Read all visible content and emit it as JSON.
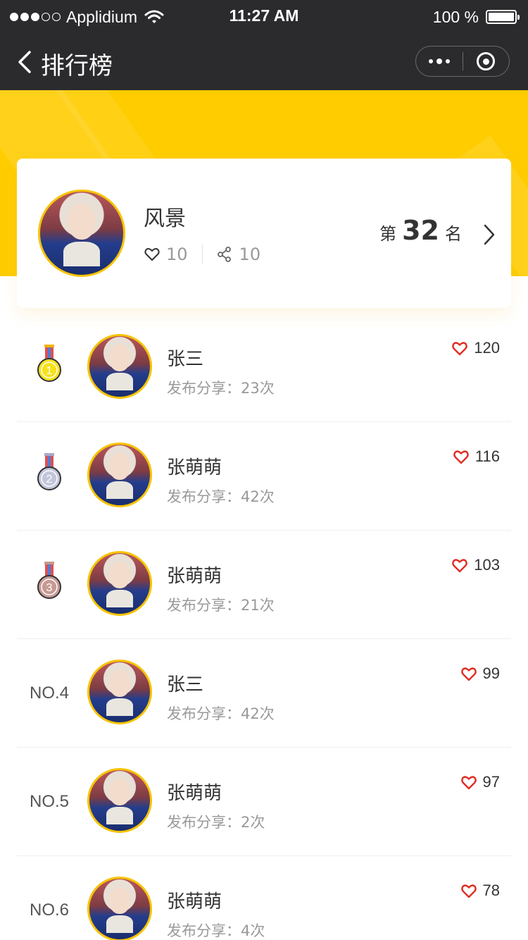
{
  "status_bar": {
    "carrier": "Applidium",
    "time": "11:27 AM",
    "battery": "100 %",
    "signal_bars_filled": 3,
    "signal_bars_total": 5
  },
  "nav": {
    "title": "排行榜",
    "back_icon": "chevron-left-icon",
    "more_icon": "more-dots-icon",
    "close_icon": "target-circle-icon"
  },
  "colors": {
    "brand_yellow": "#ffcc00",
    "nav_bg": "#2b2b2d",
    "heart_red": "#e02e24"
  },
  "my_card": {
    "name": "风景",
    "likes": "10",
    "shares": "10",
    "rank_prefix": "第",
    "rank": "32",
    "rank_suffix": "名"
  },
  "ranking": [
    {
      "rank": "1",
      "medal": "gold",
      "name": "张三",
      "sub": "发布分享：23次",
      "likes": "120"
    },
    {
      "rank": "2",
      "medal": "silver",
      "name": "张萌萌",
      "sub": "发布分享：42次",
      "likes": "116"
    },
    {
      "rank": "3",
      "medal": "bronze",
      "name": "张萌萌",
      "sub": "发布分享：21次",
      "likes": "103"
    },
    {
      "rank_label": "NO.4",
      "name": "张三",
      "sub": "发布分享：42次",
      "likes": "99"
    },
    {
      "rank_label": "NO.5",
      "name": "张萌萌",
      "sub": "发布分享：2次",
      "likes": "97"
    },
    {
      "rank_label": "NO.6",
      "name": "张萌萌",
      "sub": "发布分享：4次",
      "likes": "78"
    }
  ]
}
